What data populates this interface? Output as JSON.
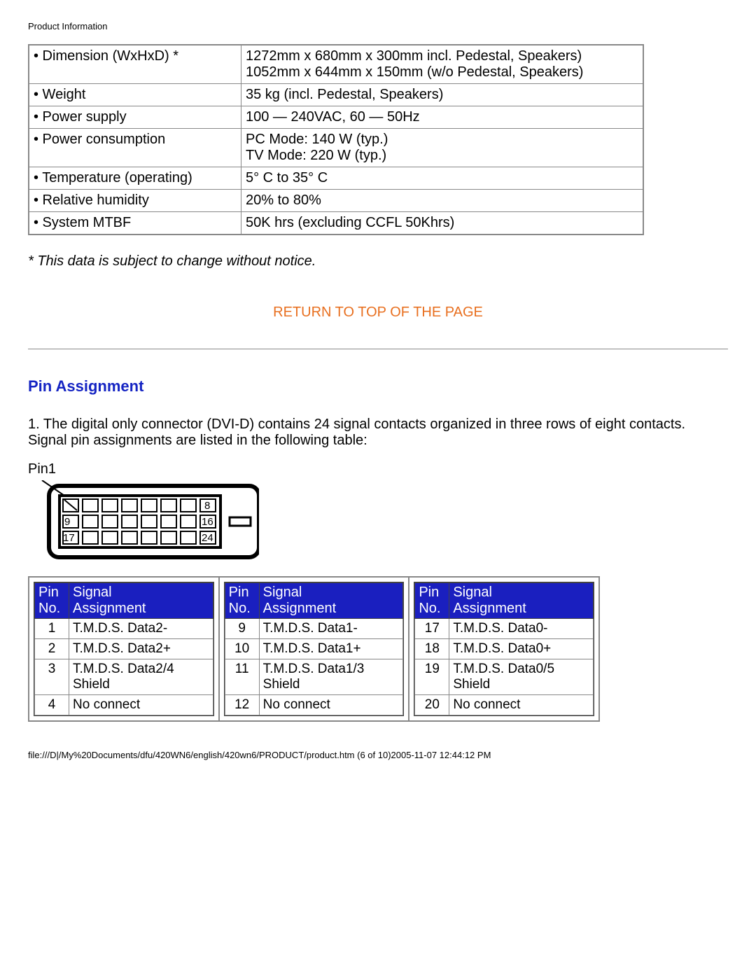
{
  "header": "Product Information",
  "specs": [
    {
      "label": "• Dimension (WxHxD) *",
      "value": "1272mm x 680mm x 300mm incl. Pedestal, Speakers)\n1052mm x 644mm x 150mm (w/o Pedestal, Speakers)"
    },
    {
      "label": "• Weight",
      "value": "35 kg (incl. Pedestal, Speakers)"
    },
    {
      "label": "• Power supply",
      "value": "100 — 240VAC, 60 — 50Hz"
    },
    {
      "label": "• Power consumption",
      "value": "PC Mode: 140 W (typ.)\nTV Mode: 220 W (typ.)"
    },
    {
      "label": "• Temperature (operating)",
      "value": "5° C to 35° C"
    },
    {
      "label": "• Relative humidity",
      "value": "20% to 80%"
    },
    {
      "label": "• System MTBF",
      "value": "50K hrs (excluding CCFL 50Khrs)"
    }
  ],
  "note": "* This data is subject to change without notice.",
  "toplink": "RETURN TO TOP OF THE PAGE",
  "section_title": "Pin Assignment",
  "body": "1. The digital only connector (DVI-D) contains 24 signal contacts organized in three rows of eight contacts. Signal pin assignments are listed in the following table:",
  "connector_label": "Pin1",
  "pin_header": {
    "no": "Pin No.",
    "assign": "Signal Assignment"
  },
  "pins_cols": [
    [
      {
        "no": "1",
        "assign": "T.M.D.S. Data2-"
      },
      {
        "no": "2",
        "assign": "T.M.D.S. Data2+"
      },
      {
        "no": "3",
        "assign": "T.M.D.S. Data2/4 Shield"
      },
      {
        "no": "4",
        "assign": "No connect"
      }
    ],
    [
      {
        "no": "9",
        "assign": "T.M.D.S. Data1-"
      },
      {
        "no": "10",
        "assign": "T.M.D.S. Data1+"
      },
      {
        "no": "11",
        "assign": "T.M.D.S. Data1/3 Shield"
      },
      {
        "no": "12",
        "assign": "No connect"
      }
    ],
    [
      {
        "no": "17",
        "assign": "T.M.D.S. Data0-"
      },
      {
        "no": "18",
        "assign": "T.M.D.S. Data0+"
      },
      {
        "no": "19",
        "assign": "T.M.D.S. Data0/5 Shield"
      },
      {
        "no": "20",
        "assign": "No connect"
      }
    ]
  ],
  "footer": "file:///D|/My%20Documents/dfu/420WN6/english/420wn6/PRODUCT/product.htm (6 of 10)2005-11-07 12:44:12 PM"
}
